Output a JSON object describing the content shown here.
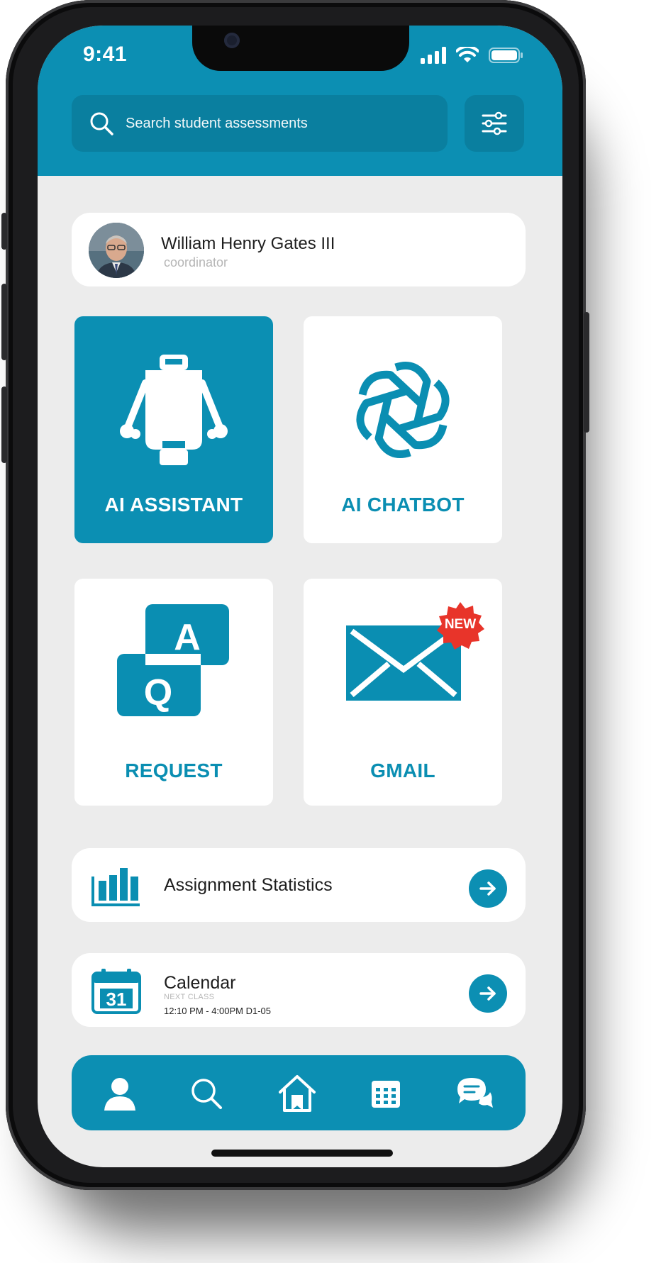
{
  "status_bar": {
    "time": "9:41"
  },
  "search": {
    "placeholder": "Search student assessments"
  },
  "profile": {
    "name": "William Henry Gates III",
    "role": "coordinator"
  },
  "tiles": [
    {
      "label": "AI ASSISTANT",
      "icon": "robot-icon"
    },
    {
      "label": "AI CHATBOT",
      "icon": "openai-icon"
    },
    {
      "label": "REQUEST",
      "icon": "qa-icon"
    },
    {
      "label": "GMAIL",
      "icon": "mail-icon",
      "badge": "NEW"
    }
  ],
  "assignment_statistics": {
    "title": "Assignment Statistics",
    "icon": "bar-chart-icon"
  },
  "calendar": {
    "title": "Calendar",
    "icon_day": "31",
    "next_class_label": "NEXT CLASS",
    "next_class_time": "12:10 PM - 4:00PM D1-05"
  },
  "bottom_nav": [
    "profile-icon",
    "search-icon",
    "home-icon",
    "calendar-icon",
    "chat-icon"
  ],
  "colors": {
    "accent": "#0c8fb3",
    "badge": "#e8342a",
    "background": "#ececec"
  }
}
